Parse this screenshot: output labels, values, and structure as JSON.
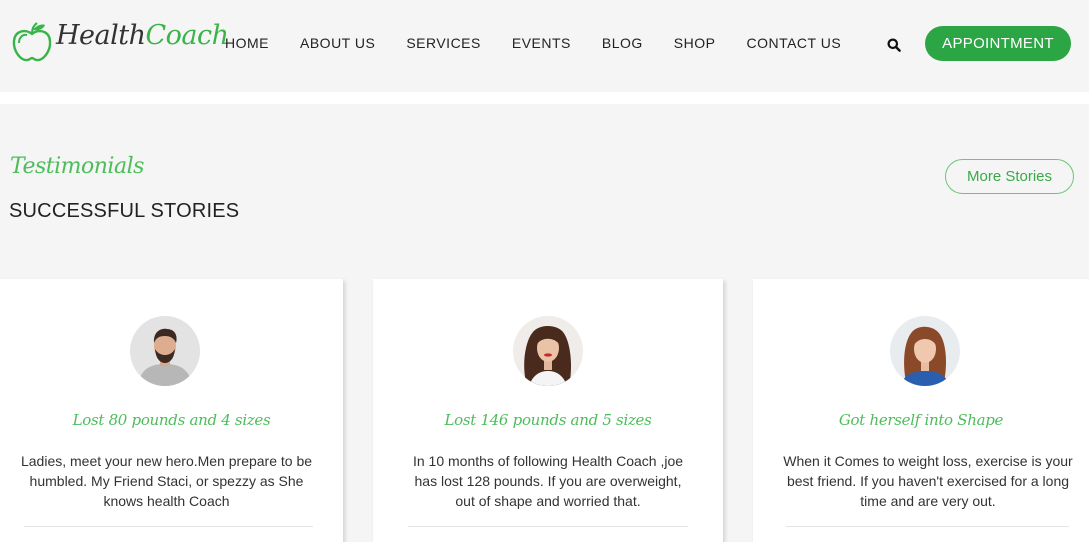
{
  "brand": {
    "name_part1": "Health",
    "name_part2": "Coach",
    "logo_icon": "apple-icon",
    "color": "#38b449"
  },
  "nav": {
    "items": [
      {
        "label": "HOME"
      },
      {
        "label": "ABOUT US"
      },
      {
        "label": "SERVICES"
      },
      {
        "label": "EVENTS"
      },
      {
        "label": "BLOG"
      },
      {
        "label": "SHOP"
      },
      {
        "label": "CONTACT US"
      }
    ],
    "search_icon": "search-icon",
    "appointment_label": "APPOINTMENT"
  },
  "testimonials": {
    "script_title": "Testimonials",
    "title": "SUCCESSFUL STORIES",
    "more_label": "More Stories",
    "cards": [
      {
        "title": "Lost 80 pounds and 4 sizes",
        "text": "Ladies, meet your new hero.Men prepare to be humbled. My Friend Staci, or spezzy as She knows health Coach",
        "avatar": "man-avatar"
      },
      {
        "title": "Lost 146 pounds and 5 sizes",
        "text": "In 10 months of following Health Coach ,joe has lost 128 pounds. If you are overweight, out of shape and worried that.",
        "avatar": "woman-avatar"
      },
      {
        "title": "Got herself into Shape",
        "text": "When it Comes to weight loss, exercise is your best friend. If you haven't exercised for a long time and are very out.",
        "avatar": "woman-avatar"
      }
    ]
  },
  "colors": {
    "accent": "#2ca645",
    "script_green": "#4cbd5a"
  }
}
